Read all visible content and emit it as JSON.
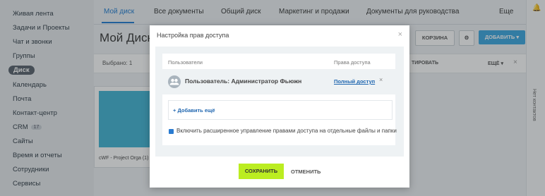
{
  "sidebar": {
    "items": [
      {
        "label": "Живая лента"
      },
      {
        "label": "Задачи и Проекты"
      },
      {
        "label": "Чат и звонки"
      },
      {
        "label": "Группы"
      },
      {
        "label": "Диск"
      },
      {
        "label": "Календарь"
      },
      {
        "label": "Почта"
      },
      {
        "label": "Контакт-центр"
      },
      {
        "label": "CRM",
        "badge": "17"
      },
      {
        "label": "Сайты"
      },
      {
        "label": "Время и отчеты"
      },
      {
        "label": "Сотрудники"
      },
      {
        "label": "Сервисы"
      }
    ]
  },
  "tabs": [
    "Мой диск",
    "Все документы",
    "Общий диск",
    "Маркетинг и продажи",
    "Документы для руководства",
    "Еще"
  ],
  "page": {
    "title": "Мой Диск",
    "trash_label": "КОРЗИНА",
    "add_label": "ДОБАВИТЬ",
    "selected_label": "Выбрано: 1",
    "more_label": "ЕЩЁ",
    "toolbar_partial": "ТИРОВАТЬ"
  },
  "file": {
    "name": "cWF - Project Orga (1)"
  },
  "right_panel": {
    "label": "Нет контактов"
  },
  "modal": {
    "title": "Настройка прав доступа",
    "col_users": "Пользователи",
    "col_access": "Права доступа",
    "user_name": "Пользователь: Администратор Фьюжн",
    "access_level": "Полный доступ",
    "add_more": "+ Добавить ещё",
    "checkbox_label": "Включить расширенное управление правами доступа на отдельные файлы и папки",
    "save": "СОХРАНИТЬ",
    "cancel": "ОТМЕНИТЬ"
  }
}
